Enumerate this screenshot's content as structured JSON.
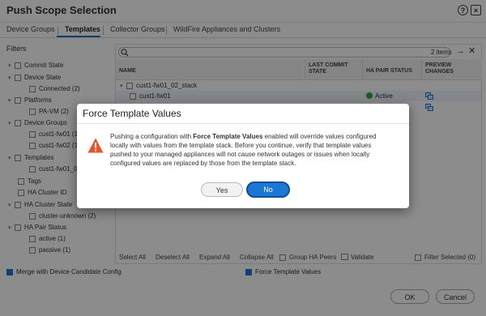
{
  "window": {
    "title": "Push Scope Selection",
    "help_glyph": "?",
    "close_glyph": "×"
  },
  "tabs": [
    {
      "label": "Device Groups"
    },
    {
      "label": "Templates"
    },
    {
      "label": "Collector Groups"
    },
    {
      "label": "WildFire Appliances and Clusters"
    }
  ],
  "filters": {
    "heading": "Filters",
    "items": [
      {
        "label": "Commit State"
      },
      {
        "label": "Device State"
      },
      {
        "label": "Connected (2)"
      },
      {
        "label": "Platforms"
      },
      {
        "label": "PA-VM (2)"
      },
      {
        "label": "Device Groups"
      },
      {
        "label": "cust1-fw01 (1)"
      },
      {
        "label": "cust1-fw02 (1)"
      },
      {
        "label": "Templates"
      },
      {
        "label": "cust1-fw01_02_stack (2)"
      },
      {
        "label": "Tags"
      },
      {
        "label": "HA Cluster ID"
      },
      {
        "label": "HA Cluster State"
      },
      {
        "label": "cluster-unknown (2)"
      },
      {
        "label": "HA Pair Status"
      },
      {
        "label": "active (1)"
      },
      {
        "label": "passive (1)"
      }
    ]
  },
  "table": {
    "count": "2 items",
    "columns": {
      "name": "NAME",
      "last_commit": "LAST COMMIT",
      "last_commit2": "STATE",
      "ha": "HA PAIR STATUS",
      "preview": "PREVIEW",
      "preview2": "CHANGES"
    },
    "rows": [
      {
        "name": "cust1-fw01_02_stack"
      },
      {
        "name": "cust1-fw01",
        "ha": "Active"
      }
    ]
  },
  "table_actions": {
    "select_all": "Select All",
    "deselect_all": "Deselect All",
    "expand_all": "Expand All",
    "collapse_all": "Collapse All",
    "group_ha": "Group HA Peers",
    "validate": "Validate",
    "filter_selected": "Filter Selected (0)"
  },
  "footer": {
    "merge_label": "Merge with Device Candidate Config",
    "force_label": "Force Template Values",
    "ok": "OK",
    "cancel": "Cancel"
  },
  "modal": {
    "title": "Force Template Values",
    "message_pre": "Pushing a configuration with ",
    "message_bold": "Force Template Values",
    "message_post": " enabled will override values configured locally with values from the template stack. Before you continue, verify that template values pushed to your managed appliances will not cause network outages or issues when locally configured values are replaced by those from the template stack.",
    "yes": "Yes",
    "no": "No"
  },
  "colors": {
    "accent": "#1b77d6",
    "warning": "#e8542c",
    "active_status": "#2eaa3a",
    "passive_status": "#e8542c"
  }
}
